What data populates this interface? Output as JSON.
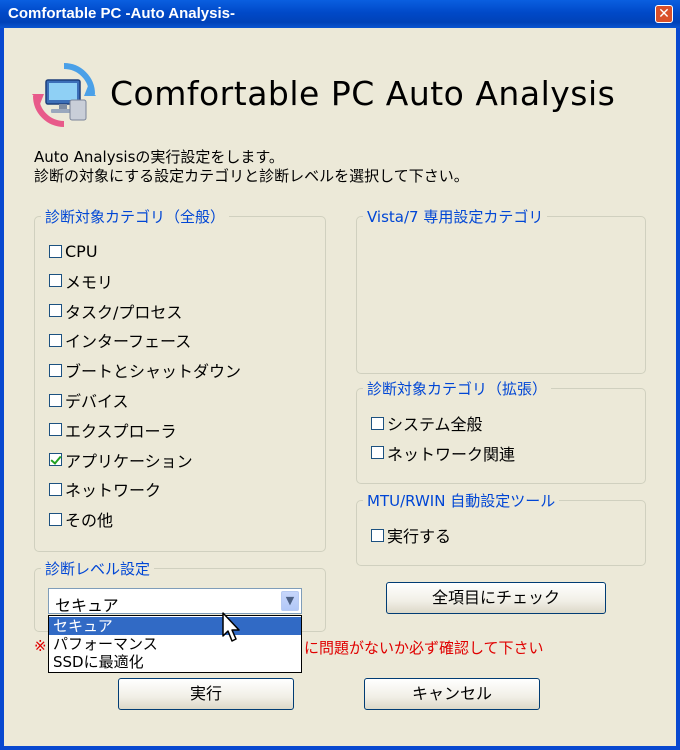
{
  "window": {
    "title": "Comfortable PC -Auto Analysis-",
    "close_glyph": "✕"
  },
  "header": {
    "app_name": "Comfortable PC Auto Analysis",
    "icon": "pc-analysis-logo-icon"
  },
  "description": {
    "line1": "Auto Analysisの実行設定をします。",
    "line2": "診断の対象にする設定カテゴリと診断レベルを選択して下さい。"
  },
  "general_categories": {
    "title": "診断対象カテゴリ（全般）",
    "items": [
      {
        "label": "CPU",
        "checked": false
      },
      {
        "label": "メモリ",
        "checked": false
      },
      {
        "label": "タスク/プロセス",
        "checked": false
      },
      {
        "label": "インターフェース",
        "checked": false
      },
      {
        "label": "ブートとシャットダウン",
        "checked": false
      },
      {
        "label": "デバイス",
        "checked": false
      },
      {
        "label": "エクスプローラ",
        "checked": false
      },
      {
        "label": "アプリケーション",
        "checked": true
      },
      {
        "label": "ネットワーク",
        "checked": false
      },
      {
        "label": "その他",
        "checked": false
      }
    ]
  },
  "vista_categories": {
    "title": "Vista/7 専用設定カテゴリ"
  },
  "extended_categories": {
    "title": "診断対象カテゴリ（拡張）",
    "items": [
      {
        "label": "システム全般",
        "checked": false
      },
      {
        "label": "ネットワーク関連",
        "checked": false
      }
    ]
  },
  "mtu_tool": {
    "title": "MTU/RWIN 自動設定ツール",
    "items": [
      {
        "label": "実行する",
        "checked": false
      }
    ]
  },
  "level": {
    "title": "診断レベル設定",
    "selected": "セキュア",
    "options": [
      "セキュア",
      "パフォーマンス",
      "SSDに最適化"
    ],
    "highlighted_index": 0
  },
  "warning": {
    "prefix": "※",
    "text": "に問題がないか必ず確認して下さい"
  },
  "buttons": {
    "check_all": "全項目にチェック",
    "run": "実行",
    "cancel": "キャンセル"
  },
  "colors": {
    "legend_blue": "#0046d5",
    "warning_red": "#e00000",
    "dialog_bg": "#ece9d8",
    "selection_blue": "#316ac5"
  }
}
